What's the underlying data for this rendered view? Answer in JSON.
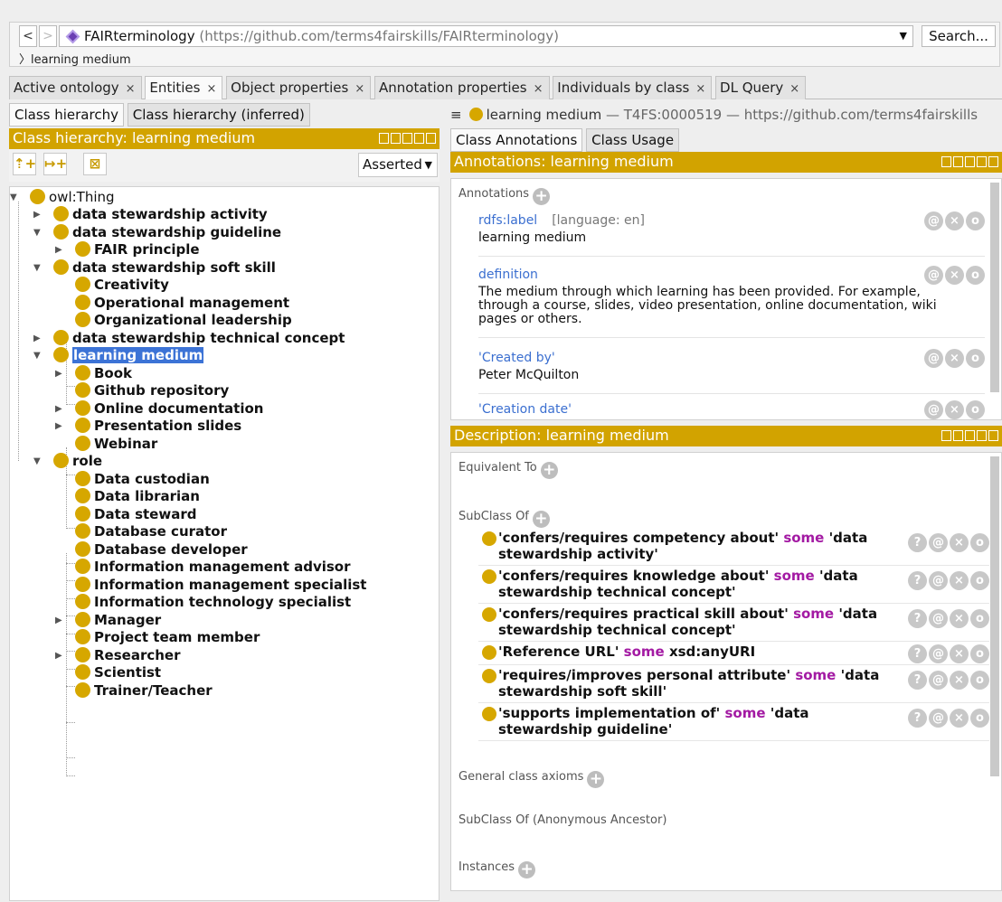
{
  "topbar": {
    "back_label": "<",
    "forward_label": ">",
    "ontology_name": "FAIRterminology",
    "ontology_url": "(https://github.com/terms4fairskills/FAIRterminology)",
    "search_label": "Search...",
    "breadcrumb": "learning medium"
  },
  "tabs": [
    {
      "label": "Active ontology"
    },
    {
      "label": "Entities"
    },
    {
      "label": "Object properties"
    },
    {
      "label": "Annotation properties"
    },
    {
      "label": "Individuals by class"
    },
    {
      "label": "DL Query"
    }
  ],
  "left": {
    "subtabs": [
      "Class hierarchy",
      "Class hierarchy (inferred)"
    ],
    "view_title": "Class hierarchy: learning medium",
    "mode_select": "Asserted",
    "tree": [
      {
        "label": "owl:Thing"
      },
      {
        "label": "data stewardship activity"
      },
      {
        "label": "data stewardship guideline"
      },
      {
        "label": "FAIR principle"
      },
      {
        "label": "data stewardship soft skill"
      },
      {
        "label": "Creativity"
      },
      {
        "label": "Operational management"
      },
      {
        "label": "Organizational leadership"
      },
      {
        "label": "data stewardship technical concept"
      },
      {
        "label": "learning medium"
      },
      {
        "label": "Book"
      },
      {
        "label": "Github repository"
      },
      {
        "label": "Online documentation"
      },
      {
        "label": "Presentation slides"
      },
      {
        "label": "Webinar"
      },
      {
        "label": "role"
      },
      {
        "label": "Data custodian"
      },
      {
        "label": "Data librarian"
      },
      {
        "label": "Data steward"
      },
      {
        "label": "Database curator"
      },
      {
        "label": "Database developer"
      },
      {
        "label": "Information management advisor"
      },
      {
        "label": "Information management specialist"
      },
      {
        "label": "Information technology specialist"
      },
      {
        "label": "Manager"
      },
      {
        "label": "Project team member"
      },
      {
        "label": "Researcher"
      },
      {
        "label": "Scientist"
      },
      {
        "label": "Trainer/Teacher"
      }
    ]
  },
  "right": {
    "entity_name": "learning medium",
    "entity_meta": "— T4FS:0000519 — https://github.com/terms4fairskills",
    "subtabs": [
      "Class Annotations",
      "Class Usage"
    ],
    "annotations_title": "Annotations: learning medium",
    "annotations_header": "Annotations",
    "annotations": [
      {
        "property": "rdfs:label",
        "lang": "[language: en]",
        "value": "learning medium"
      },
      {
        "property": "definition",
        "lang": "",
        "value": "The medium through which learning has been provided. For example, through a course, slides, video presentation, online documentation, wiki pages or others."
      },
      {
        "property": "'Created by'",
        "lang": "",
        "value": "Peter McQuilton"
      },
      {
        "property": "'Creation date'",
        "lang": "",
        "value": ""
      }
    ],
    "description_title": "Description: learning medium",
    "equivalent_label": "Equivalent To",
    "subclass_label": "SubClass Of",
    "subclass_axioms": [
      {
        "pre": "'confers/requires competency about'",
        "kw": "some",
        "post": "'data stewardship activity'"
      },
      {
        "pre": "'confers/requires knowledge about'",
        "kw": "some",
        "post": "'data stewardship technical concept'"
      },
      {
        "pre": "'confers/requires practical skill about'",
        "kw": "some",
        "post": "'data stewardship technical concept'"
      },
      {
        "pre": "'Reference URL'",
        "kw": "some",
        "post": "xsd:anyURI"
      },
      {
        "pre": "'requires/improves personal attribute'",
        "kw": "some",
        "post": "'data stewardship soft skill'"
      },
      {
        "pre": "'supports implementation of'",
        "kw": "some",
        "post": "'data stewardship guideline'"
      }
    ],
    "general_axioms_label": "General class axioms",
    "anon_ancestor_label": "SubClass Of (Anonymous Ancestor)",
    "instances_label": "Instances"
  },
  "icons": {
    "add": "+",
    "annotate": "@",
    "delete": "×",
    "edit": "o",
    "explain": "?"
  },
  "colors": {
    "view_header": "#d2a300",
    "class_dot": "#d6a700",
    "selection": "#3c73d6",
    "keyword": "#a31aa3",
    "annotation_property": "#3b6fd0"
  }
}
